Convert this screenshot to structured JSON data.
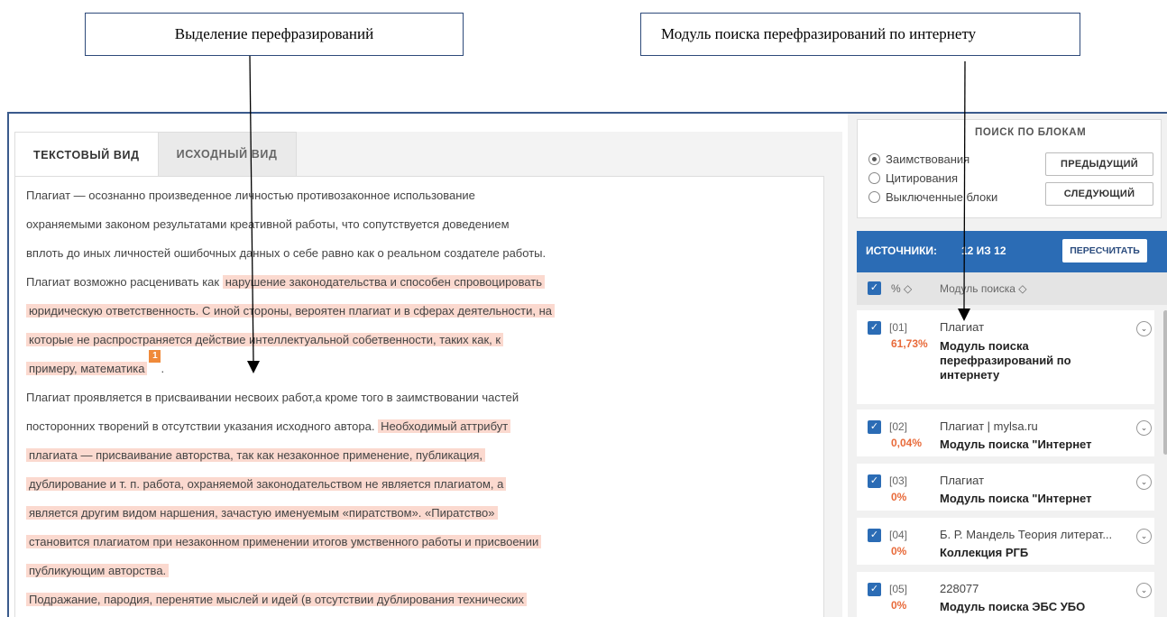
{
  "callouts": {
    "left": "Выделение перефразирований",
    "right": "Модуль поиска перефразирований по интернету"
  },
  "tabs": [
    {
      "label": "ТЕКСТОВЫЙ ВИД",
      "active": true
    },
    {
      "label": "ИСХОДНЫЙ ВИД",
      "active": false
    }
  ],
  "text_lines": [
    {
      "plain": "Плагиат — осознанно произведенное личностью противозаконное использование",
      "hl": ""
    },
    {
      "plain": "охраняемыми законом результатами креативной работы, что сопутствуется доведением",
      "hl": ""
    },
    {
      "plain": "вплоть до иных личностей ошибочных данных о себе равно как о реальном создателе работы.",
      "hl": ""
    },
    {
      "plain": "Плагиат возможно расценивать как ",
      "hl": "нарушение законодательства и способен спровоцировать"
    },
    {
      "plain": "",
      "hl": "юридическую ответственность. С иной стороны, вероятен плагиат и в сферах деятельности, на"
    },
    {
      "plain": "",
      "hl": "которые не распространяется действие интеллектуальной собетвенности, таких как, к"
    },
    {
      "plain": "",
      "hl": "примеру, математика",
      "after": ".",
      "marker": "1"
    },
    {
      "plain": "Плагиат проявляется в присваивании несвоих работ,а кроме того в заимствовании частей",
      "hl": ""
    },
    {
      "plain": "посторонних творений в отсутствии указания исходного автора. ",
      "hl": "Необходимый аттрибут"
    },
    {
      "plain": "",
      "hl": "плагиата — присваивание авторства, так как незаконное применение, публикация,"
    },
    {
      "plain": "",
      "hl": "дублирование и т. п. работа, охраняемой законодательством не является плагиатом, а"
    },
    {
      "plain": "",
      "hl": "является другим видом наршения, зачастую именуемым «пиратством». «Пиратство»"
    },
    {
      "plain": "",
      "hl": "становится плагиатом при незаконном применении итогов умственного работы и присвоении"
    },
    {
      "plain": "",
      "hl": "публикующим авторства."
    },
    {
      "plain": "",
      "hl": "Подражание, пародия, перенятие мыслей и идей (в отсутствии дублирования технических"
    }
  ],
  "blocks": {
    "title": "ПОИСК ПО БЛОКАМ",
    "options": [
      {
        "label": "Заимствования",
        "selected": true
      },
      {
        "label": "Цитирования",
        "selected": false
      },
      {
        "label": "Выключенные блоки",
        "selected": false
      }
    ],
    "prev_label": "ПРЕДЫДУЩИЙ",
    "next_label": "СЛЕДУЮЩИЙ"
  },
  "sources": {
    "label": "ИСТОЧНИКИ:",
    "count": "12 ИЗ 12",
    "recalc_label": "ПЕРЕСЧИТАТЬ",
    "col_percent": "% ◇",
    "col_module": "Модуль поиска ◇",
    "items": [
      {
        "num": "[01]",
        "pct": "61,73%",
        "name": "Плагиат",
        "module": "Модуль поиска перефразирований по интернету"
      },
      {
        "num": "[02]",
        "pct": "0,04%",
        "name": "Плагиат | mylsa.ru",
        "module": "Модуль поиска \"Интернет"
      },
      {
        "num": "[03]",
        "pct": "0%",
        "name": "Плагиат",
        "module": "Модуль поиска \"Интернет"
      },
      {
        "num": "[04]",
        "pct": "0%",
        "name": "Б. Р. Мандель Теория литерат...",
        "module": "Коллекция РГБ"
      },
      {
        "num": "[05]",
        "pct": "0%",
        "name": "228077",
        "module": "Модуль поиска ЭБС УБО"
      }
    ]
  },
  "colors": {
    "accent": "#2b6cb5",
    "highlight": "#fbd9cf",
    "percent": "#e86a3a",
    "marker": "#f08a3a"
  }
}
